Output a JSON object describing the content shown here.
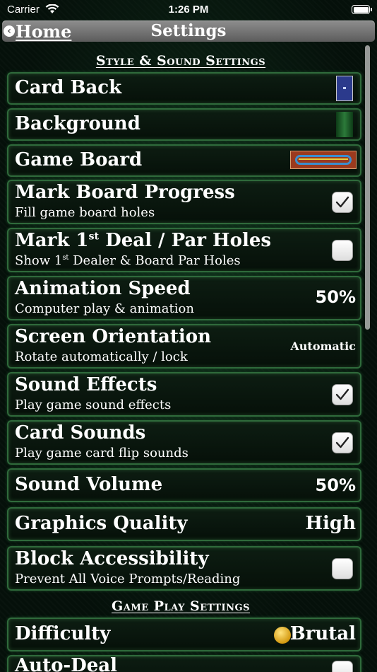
{
  "status_bar": {
    "carrier": "Carrier",
    "time": "1:26 PM"
  },
  "nav": {
    "back_label": "Home",
    "title": "Settings"
  },
  "sections": {
    "style_sound": "Style & Sound Settings",
    "game_play": "Game Play Settings"
  },
  "rows": {
    "card_back": {
      "title": "Card Back"
    },
    "background": {
      "title": "Background"
    },
    "game_board": {
      "title": "Game Board"
    },
    "mark_board": {
      "title": "Mark Board Progress",
      "subtitle": "Fill game board holes",
      "checked": true
    },
    "mark_first_deal": {
      "title_a": "Mark 1",
      "title_sup": "st",
      "title_b": " Deal / Par Holes",
      "subtitle_a": "Show 1",
      "subtitle_sup": "st",
      "subtitle_b": " Dealer & Board Par Holes",
      "checked": false
    },
    "animation_speed": {
      "title": "Animation Speed",
      "subtitle": "Computer play & animation",
      "value": "50%"
    },
    "screen_orientation": {
      "title": "Screen Orientation",
      "subtitle": "Rotate automatically / lock",
      "value": "Automatic"
    },
    "sound_effects": {
      "title": "Sound Effects",
      "subtitle": "Play game sound effects",
      "checked": true
    },
    "card_sounds": {
      "title": "Card Sounds",
      "subtitle": "Play game card flip sounds",
      "checked": true
    },
    "sound_volume": {
      "title": "Sound Volume",
      "value": "50%"
    },
    "graphics_quality": {
      "title": "Graphics Quality",
      "value": "High"
    },
    "block_accessibility": {
      "title": "Block Accessibility",
      "subtitle": "Prevent All Voice Prompts/Reading",
      "checked": false
    },
    "difficulty": {
      "title": "Difficulty",
      "value": "Brutal"
    },
    "auto_deal": {
      "title": "Auto-Deal"
    }
  },
  "colors": {
    "row_border": "#2f6a3b",
    "nav_bar": "#7a7a7a",
    "background": "#05100a"
  }
}
